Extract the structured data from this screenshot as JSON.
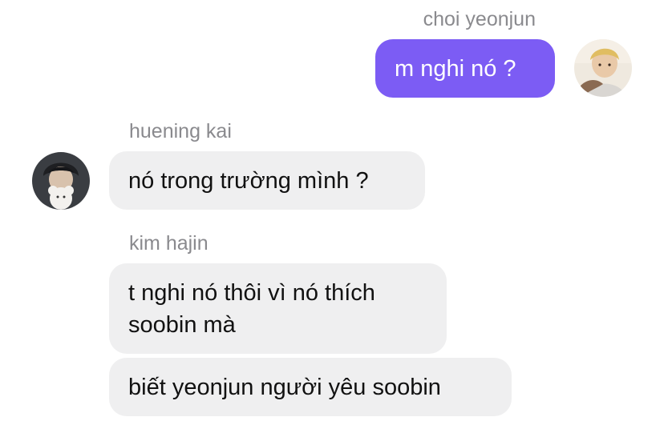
{
  "messages": [
    {
      "sender": "choi yeonjun",
      "lines": [
        "m nghi nó ?"
      ]
    },
    {
      "sender": "huening kai",
      "lines": [
        "nó trong trường mình ?"
      ]
    },
    {
      "sender": "kim hajin",
      "lines": [
        "t nghi nó thôi vì nó thích\nsoobin mà",
        "biết yeonjun người yêu soobin"
      ]
    }
  ],
  "colors": {
    "outgoing_bubble": "#7c5cf4",
    "incoming_bubble": "#efeff0",
    "sender_name": "#8a8a8e"
  }
}
